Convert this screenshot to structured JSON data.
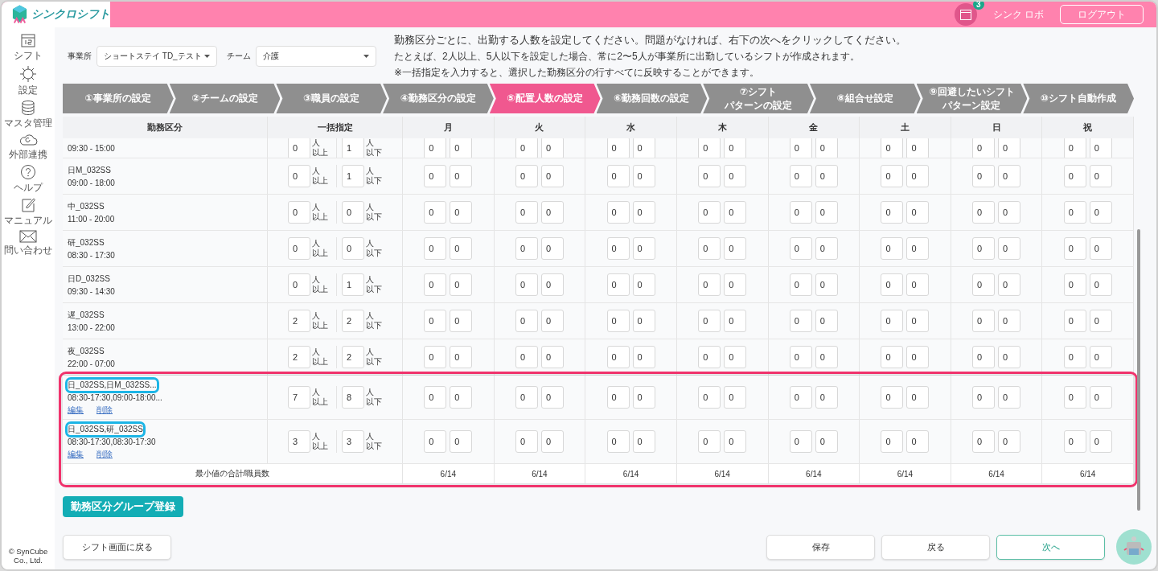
{
  "header": {
    "app_name": "シンクロシフト",
    "notification_count": "3",
    "user_name": "シンク ロボ",
    "logout": "ログアウト"
  },
  "sidebar": {
    "items": [
      {
        "label": "シフト"
      },
      {
        "label": "設定"
      },
      {
        "label": "マスタ管理"
      },
      {
        "label": "外部連携"
      },
      {
        "label": "ヘルプ"
      },
      {
        "label": "マニュアル"
      },
      {
        "label": "問い合わせ"
      }
    ],
    "copyright": "© SynCube Co., Ltd."
  },
  "filters": [
    {
      "label": "事業所",
      "value": "ショートステイ TD_テスト"
    },
    {
      "label": "チーム",
      "value": "介護"
    }
  ],
  "instructions": [
    "勤務区分ごとに、出勤する人数を設定してください。問題がなければ、右下の次へをクリックしてください。",
    "たとえば、2人以上、5人以下を設定した場合、常に2〜5人が事業所に出勤しているシフトが作成されます。",
    "※一括指定を入力すると、選択した勤務区分の行すべてに反映することができます。"
  ],
  "steps": [
    {
      "lines": [
        "①事業所の設定"
      ],
      "selected": false
    },
    {
      "lines": [
        "②チームの設定"
      ],
      "selected": false
    },
    {
      "lines": [
        "③職員の設定"
      ],
      "selected": false
    },
    {
      "lines": [
        "④勤務区分の設定"
      ],
      "selected": false
    },
    {
      "lines": [
        "⑤配置人数の設定"
      ],
      "selected": true
    },
    {
      "lines": [
        "⑥勤務回数の設定"
      ],
      "selected": false
    },
    {
      "lines": [
        "⑦シフト",
        "パターンの設定"
      ],
      "selected": false
    },
    {
      "lines": [
        "⑧組合せ設定"
      ],
      "selected": false
    },
    {
      "lines": [
        "⑨回避したいシフト",
        "パターン設定"
      ],
      "selected": false
    },
    {
      "lines": [
        "⑩シフト自動作成"
      ],
      "selected": false
    }
  ],
  "table": {
    "columns": [
      "勤務区分",
      "一括指定",
      "月",
      "火",
      "水",
      "木",
      "金",
      "土",
      "日",
      "祝"
    ],
    "rows": [
      {
        "kind": "partial",
        "time": "09:30 - 15:00",
        "min": "0",
        "min_unit": "人",
        "min_suffix": "以上",
        "max": "1",
        "max_unit": "人",
        "max_suffix": "以下",
        "days": [
          "0",
          "0",
          "0",
          "0",
          "0",
          "0",
          "0",
          "0",
          "0",
          "0",
          "0",
          "0",
          "0",
          "0",
          "0",
          "0"
        ]
      },
      {
        "kind": "shift",
        "name": "日M_032SS",
        "time": "09:00 - 18:00",
        "min": "0",
        "min_unit": "人",
        "min_suffix": "以上",
        "max": "1",
        "max_unit": "人",
        "max_suffix": "以下",
        "days": [
          "0",
          "0",
          "0",
          "0",
          "0",
          "0",
          "0",
          "0",
          "0",
          "0",
          "0",
          "0",
          "0",
          "0",
          "0",
          "0"
        ]
      },
      {
        "kind": "shift",
        "name": "中_032SS",
        "time": "11:00 - 20:00",
        "min": "0",
        "min_unit": "人",
        "min_suffix": "以上",
        "max": "0",
        "max_unit": "人",
        "max_suffix": "以下",
        "days": [
          "0",
          "0",
          "0",
          "0",
          "0",
          "0",
          "0",
          "0",
          "0",
          "0",
          "0",
          "0",
          "0",
          "0",
          "0",
          "0"
        ]
      },
      {
        "kind": "shift",
        "name": "研_032SS",
        "time": "08:30 - 17:30",
        "min": "0",
        "min_unit": "人",
        "min_suffix": "以上",
        "max": "0",
        "max_unit": "人",
        "max_suffix": "以下",
        "days": [
          "0",
          "0",
          "0",
          "0",
          "0",
          "0",
          "0",
          "0",
          "0",
          "0",
          "0",
          "0",
          "0",
          "0",
          "0",
          "0"
        ]
      },
      {
        "kind": "shift",
        "name": "日D_032SS",
        "time": "09:30 - 14:30",
        "min": "0",
        "min_unit": "人",
        "min_suffix": "以上",
        "max": "1",
        "max_unit": "人",
        "max_suffix": "以下",
        "days": [
          "0",
          "0",
          "0",
          "0",
          "0",
          "0",
          "0",
          "0",
          "0",
          "0",
          "0",
          "0",
          "0",
          "0",
          "0",
          "0"
        ]
      },
      {
        "kind": "shift",
        "name": "遅_032SS",
        "time": "13:00 - 22:00",
        "min": "2",
        "min_unit": "人",
        "min_suffix": "以上",
        "max": "2",
        "max_unit": "人",
        "max_suffix": "以下",
        "days": [
          "0",
          "0",
          "0",
          "0",
          "0",
          "0",
          "0",
          "0",
          "0",
          "0",
          "0",
          "0",
          "0",
          "0",
          "0",
          "0"
        ]
      },
      {
        "kind": "shift",
        "name": "夜_032SS",
        "time": "22:00 - 07:00",
        "min": "2",
        "min_unit": "人",
        "min_suffix": "以上",
        "max": "2",
        "max_unit": "人",
        "max_suffix": "以下",
        "days": [
          "0",
          "0",
          "0",
          "0",
          "0",
          "0",
          "0",
          "0",
          "0",
          "0",
          "0",
          "0",
          "0",
          "0",
          "0",
          "0"
        ]
      }
    ],
    "groups_highlighted": true,
    "groups": [
      {
        "name": "日_032SS,日M_032SS...",
        "name_highlighted": true,
        "time": "08:30-17:30,09:00-18:00...",
        "edit": "編集",
        "delete": "削除",
        "min": "7",
        "min_unit": "人",
        "min_suffix": "以上",
        "max": "8",
        "max_unit": "人",
        "max_suffix": "以下",
        "days": [
          "0",
          "0",
          "0",
          "0",
          "0",
          "0",
          "0",
          "0",
          "0",
          "0",
          "0",
          "0",
          "0",
          "0",
          "0",
          "0"
        ]
      },
      {
        "name": "日_032SS,研_032SS",
        "name_highlighted": true,
        "time": "08:30-17:30,08:30-17:30",
        "edit": "編集",
        "delete": "削除",
        "min": "3",
        "min_unit": "人",
        "min_suffix": "以上",
        "max": "3",
        "max_unit": "人",
        "max_suffix": "以下",
        "days": [
          "0",
          "0",
          "0",
          "0",
          "0",
          "0",
          "0",
          "0",
          "0",
          "0",
          "0",
          "0",
          "0",
          "0",
          "0",
          "0"
        ]
      }
    ],
    "summary": {
      "label": "最小値の合計/職員数",
      "values": [
        "6/14",
        "6/14",
        "6/14",
        "6/14",
        "6/14",
        "6/14",
        "6/14",
        "6/14"
      ]
    }
  },
  "group_button": "勤務区分グループ登録",
  "back_to_shift": "シフト画面に戻る",
  "actions": [
    {
      "label": "保存",
      "kind": "plain"
    },
    {
      "label": "戻る",
      "kind": "plain"
    },
    {
      "label": "次へ",
      "kind": "primary"
    }
  ]
}
